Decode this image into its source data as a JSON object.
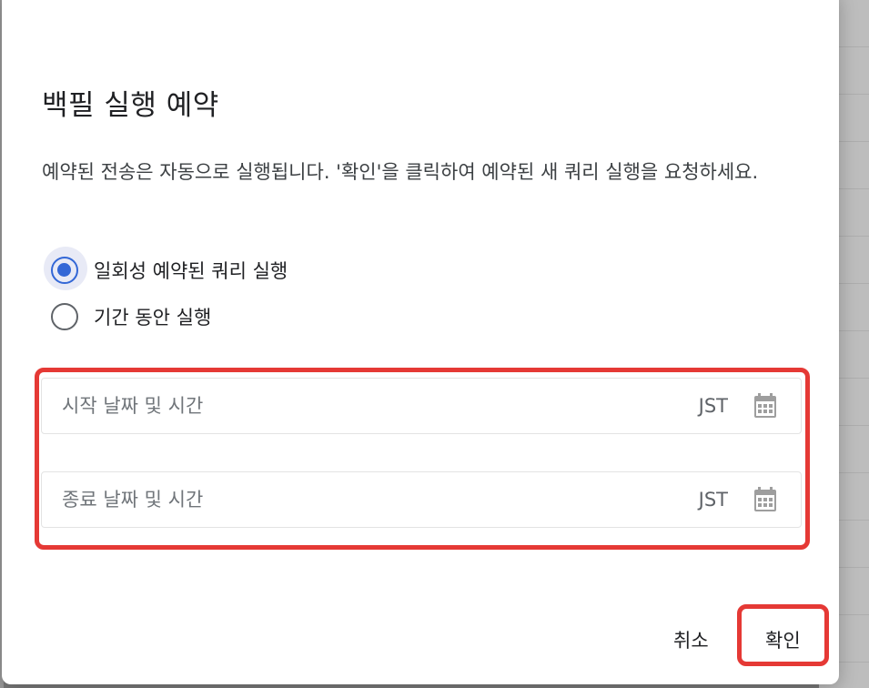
{
  "dialog": {
    "title": "백필 실행 예약",
    "description": "예약된 전송은 자동으로 실행됩니다. '확인'을 클릭하여 예약된 새 쿼리 실행을 요청하세요.",
    "options": [
      {
        "label": "일회성 예약된 쿼리 실행",
        "selected": true
      },
      {
        "label": "기간 동안 실행",
        "selected": false
      }
    ],
    "start_field": {
      "placeholder": "시작 날짜 및 시간",
      "timezone": "JST",
      "icon": "calendar-icon"
    },
    "end_field": {
      "placeholder": "종료 날짜 및 시간",
      "timezone": "JST",
      "icon": "calendar-icon"
    },
    "buttons": {
      "cancel": "취소",
      "ok": "확인"
    }
  },
  "colors": {
    "accent": "#3367d6",
    "annotation": "#e53935",
    "text_primary": "#202124",
    "text_secondary": "#70757a"
  }
}
